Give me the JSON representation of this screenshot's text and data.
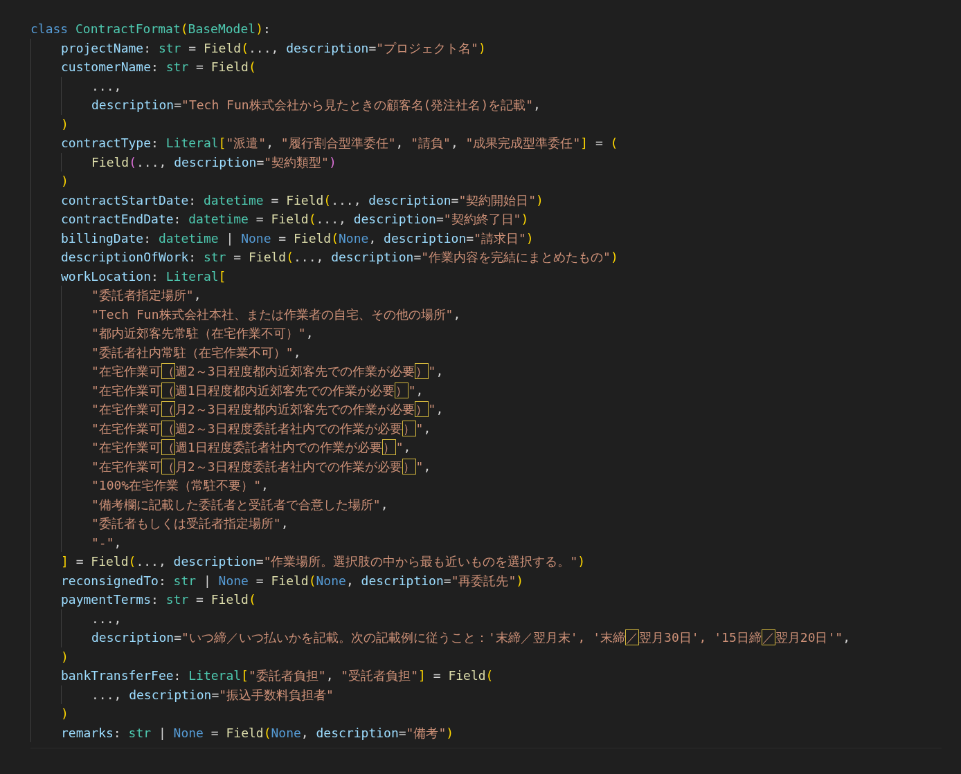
{
  "editor": {
    "lines": [
      {
        "tokens": [
          {
            "kind": "kw",
            "text": "class "
          },
          {
            "kind": "cls",
            "text": "ContractFormat"
          },
          {
            "kind": "p1",
            "text": "("
          },
          {
            "kind": "cls",
            "text": "BaseModel"
          },
          {
            "kind": "p1",
            "text": ")"
          },
          {
            "kind": "op",
            "text": ":"
          }
        ],
        "children": [
          {
            "tokens": [
              {
                "kind": "var",
                "text": "projectName"
              },
              {
                "kind": "op",
                "text": ": "
              },
              {
                "kind": "type",
                "text": "str"
              },
              {
                "kind": "op",
                "text": " = "
              },
              {
                "kind": "fn",
                "text": "Field"
              },
              {
                "kind": "p1",
                "text": "("
              },
              {
                "kind": "op",
                "text": "..., "
              },
              {
                "kind": "var",
                "text": "description"
              },
              {
                "kind": "op",
                "text": "="
              },
              {
                "kind": "str",
                "text": "\"プロジェクト名\""
              },
              {
                "kind": "p1",
                "text": ")"
              }
            ]
          },
          {
            "tokens": [
              {
                "kind": "var",
                "text": "customerName"
              },
              {
                "kind": "op",
                "text": ": "
              },
              {
                "kind": "type",
                "text": "str"
              },
              {
                "kind": "op",
                "text": " = "
              },
              {
                "kind": "fn",
                "text": "Field"
              },
              {
                "kind": "p1",
                "text": "("
              }
            ],
            "children": [
              {
                "tokens": [
                  {
                    "kind": "op",
                    "text": "...,"
                  }
                ]
              },
              {
                "tokens": [
                  {
                    "kind": "var",
                    "text": "description"
                  },
                  {
                    "kind": "op",
                    "text": "="
                  },
                  {
                    "kind": "str",
                    "text": "\"Tech Fun株式会社から見たときの顧客名(発注社名)を記載\""
                  },
                  {
                    "kind": "op",
                    "text": ","
                  }
                ]
              }
            ]
          },
          {
            "tokens": [
              {
                "kind": "p1",
                "text": ")"
              }
            ]
          },
          {
            "tokens": [
              {
                "kind": "var",
                "text": "contractType"
              },
              {
                "kind": "op",
                "text": ": "
              },
              {
                "kind": "type",
                "text": "Literal"
              },
              {
                "kind": "p1",
                "text": "["
              },
              {
                "kind": "str",
                "text": "\"派遣\""
              },
              {
                "kind": "op",
                "text": ", "
              },
              {
                "kind": "str",
                "text": "\"履行割合型準委任\""
              },
              {
                "kind": "op",
                "text": ", "
              },
              {
                "kind": "str",
                "text": "\"請負\""
              },
              {
                "kind": "op",
                "text": ", "
              },
              {
                "kind": "str",
                "text": "\"成果完成型準委任\""
              },
              {
                "kind": "p1",
                "text": "]"
              },
              {
                "kind": "op",
                "text": " = "
              },
              {
                "kind": "p1",
                "text": "("
              }
            ],
            "children": [
              {
                "tokens": [
                  {
                    "kind": "fn",
                    "text": "Field"
                  },
                  {
                    "kind": "p2",
                    "text": "("
                  },
                  {
                    "kind": "op",
                    "text": "..., "
                  },
                  {
                    "kind": "var",
                    "text": "description"
                  },
                  {
                    "kind": "op",
                    "text": "="
                  },
                  {
                    "kind": "str",
                    "text": "\"契約類型\""
                  },
                  {
                    "kind": "p2",
                    "text": ")"
                  }
                ]
              }
            ]
          },
          {
            "tokens": [
              {
                "kind": "p1",
                "text": ")"
              }
            ]
          },
          {
            "tokens": [
              {
                "kind": "var",
                "text": "contractStartDate"
              },
              {
                "kind": "op",
                "text": ": "
              },
              {
                "kind": "type",
                "text": "datetime"
              },
              {
                "kind": "op",
                "text": " = "
              },
              {
                "kind": "fn",
                "text": "Field"
              },
              {
                "kind": "p1",
                "text": "("
              },
              {
                "kind": "op",
                "text": "..., "
              },
              {
                "kind": "var",
                "text": "description"
              },
              {
                "kind": "op",
                "text": "="
              },
              {
                "kind": "str",
                "text": "\"契約開始日\""
              },
              {
                "kind": "p1",
                "text": ")"
              }
            ]
          },
          {
            "tokens": [
              {
                "kind": "var",
                "text": "contractEndDate"
              },
              {
                "kind": "op",
                "text": ": "
              },
              {
                "kind": "type",
                "text": "datetime"
              },
              {
                "kind": "op",
                "text": " = "
              },
              {
                "kind": "fn",
                "text": "Field"
              },
              {
                "kind": "p1",
                "text": "("
              },
              {
                "kind": "op",
                "text": "..., "
              },
              {
                "kind": "var",
                "text": "description"
              },
              {
                "kind": "op",
                "text": "="
              },
              {
                "kind": "str",
                "text": "\"契約終了日\""
              },
              {
                "kind": "p1",
                "text": ")"
              }
            ]
          },
          {
            "tokens": [
              {
                "kind": "var",
                "text": "billingDate"
              },
              {
                "kind": "op",
                "text": ": "
              },
              {
                "kind": "type",
                "text": "datetime"
              },
              {
                "kind": "op",
                "text": " | "
              },
              {
                "kind": "none",
                "text": "None"
              },
              {
                "kind": "op",
                "text": " = "
              },
              {
                "kind": "fn",
                "text": "Field"
              },
              {
                "kind": "p1",
                "text": "("
              },
              {
                "kind": "none",
                "text": "None"
              },
              {
                "kind": "op",
                "text": ", "
              },
              {
                "kind": "var",
                "text": "description"
              },
              {
                "kind": "op",
                "text": "="
              },
              {
                "kind": "str",
                "text": "\"請求日\""
              },
              {
                "kind": "p1",
                "text": ")"
              }
            ]
          },
          {
            "tokens": [
              {
                "kind": "var",
                "text": "descriptionOfWork"
              },
              {
                "kind": "op",
                "text": ": "
              },
              {
                "kind": "type",
                "text": "str"
              },
              {
                "kind": "op",
                "text": " = "
              },
              {
                "kind": "fn",
                "text": "Field"
              },
              {
                "kind": "p1",
                "text": "("
              },
              {
                "kind": "op",
                "text": "..., "
              },
              {
                "kind": "var",
                "text": "description"
              },
              {
                "kind": "op",
                "text": "="
              },
              {
                "kind": "str",
                "text": "\"作業内容を完結にまとめたもの\""
              },
              {
                "kind": "p1",
                "text": ")"
              }
            ]
          },
          {
            "tokens": [
              {
                "kind": "var",
                "text": "workLocation"
              },
              {
                "kind": "op",
                "text": ": "
              },
              {
                "kind": "type",
                "text": "Literal"
              },
              {
                "kind": "p1",
                "text": "["
              }
            ],
            "children": [
              {
                "tokens": [
                  {
                    "kind": "str",
                    "text": "\"委託者指定場所\""
                  },
                  {
                    "kind": "op",
                    "text": ","
                  }
                ]
              },
              {
                "tokens": [
                  {
                    "kind": "str",
                    "text": "\"Tech Fun株式会社本社、または作業者の自宅、その他の場所\""
                  },
                  {
                    "kind": "op",
                    "text": ","
                  }
                ]
              },
              {
                "tokens": [
                  {
                    "kind": "str",
                    "text": "\"都内近郊客先常駐（在宅作業不可）\""
                  },
                  {
                    "kind": "op",
                    "text": ","
                  }
                ]
              },
              {
                "tokens": [
                  {
                    "kind": "str",
                    "text": "\"委託者社内常駐（在宅作業不可）\""
                  },
                  {
                    "kind": "op",
                    "text": ","
                  }
                ]
              },
              {
                "tokens": [
                  {
                    "kind": "str",
                    "text": "\"在宅作業可"
                  },
                  {
                    "kind": "amb",
                    "text": "（"
                  },
                  {
                    "kind": "str",
                    "text": "週2～3日程度都内近郊客先での作業が必要"
                  },
                  {
                    "kind": "amb",
                    "text": "）"
                  },
                  {
                    "kind": "str",
                    "text": "\""
                  },
                  {
                    "kind": "op",
                    "text": ","
                  }
                ]
              },
              {
                "tokens": [
                  {
                    "kind": "str",
                    "text": "\"在宅作業可"
                  },
                  {
                    "kind": "amb",
                    "text": "（"
                  },
                  {
                    "kind": "str",
                    "text": "週1日程度都内近郊客先での作業が必要"
                  },
                  {
                    "kind": "amb",
                    "text": "）"
                  },
                  {
                    "kind": "str",
                    "text": "\""
                  },
                  {
                    "kind": "op",
                    "text": ","
                  }
                ]
              },
              {
                "tokens": [
                  {
                    "kind": "str",
                    "text": "\"在宅作業可"
                  },
                  {
                    "kind": "amb",
                    "text": "（"
                  },
                  {
                    "kind": "str",
                    "text": "月2～3日程度都内近郊客先での作業が必要"
                  },
                  {
                    "kind": "amb",
                    "text": "）"
                  },
                  {
                    "kind": "str",
                    "text": "\""
                  },
                  {
                    "kind": "op",
                    "text": ","
                  }
                ]
              },
              {
                "tokens": [
                  {
                    "kind": "str",
                    "text": "\"在宅作業可"
                  },
                  {
                    "kind": "amb",
                    "text": "（"
                  },
                  {
                    "kind": "str",
                    "text": "週2～3日程度委託者社内での作業が必要"
                  },
                  {
                    "kind": "amb",
                    "text": "）"
                  },
                  {
                    "kind": "str",
                    "text": "\""
                  },
                  {
                    "kind": "op",
                    "text": ","
                  }
                ]
              },
              {
                "tokens": [
                  {
                    "kind": "str",
                    "text": "\"在宅作業可"
                  },
                  {
                    "kind": "amb",
                    "text": "（"
                  },
                  {
                    "kind": "str",
                    "text": "週1日程度委託者社内での作業が必要"
                  },
                  {
                    "kind": "amb",
                    "text": "）"
                  },
                  {
                    "kind": "str",
                    "text": "\""
                  },
                  {
                    "kind": "op",
                    "text": ","
                  }
                ]
              },
              {
                "tokens": [
                  {
                    "kind": "str",
                    "text": "\"在宅作業可"
                  },
                  {
                    "kind": "amb",
                    "text": "（"
                  },
                  {
                    "kind": "str",
                    "text": "月2～3日程度委託者社内での作業が必要"
                  },
                  {
                    "kind": "amb",
                    "text": "）"
                  },
                  {
                    "kind": "str",
                    "text": "\""
                  },
                  {
                    "kind": "op",
                    "text": ","
                  }
                ]
              },
              {
                "tokens": [
                  {
                    "kind": "str",
                    "text": "\"100%在宅作業（常駐不要）\""
                  },
                  {
                    "kind": "op",
                    "text": ","
                  }
                ]
              },
              {
                "tokens": [
                  {
                    "kind": "str",
                    "text": "\"備考欄に記載した委託者と受託者で合意した場所\""
                  },
                  {
                    "kind": "op",
                    "text": ","
                  }
                ]
              },
              {
                "tokens": [
                  {
                    "kind": "str",
                    "text": "\"委託者もしくは受託者指定場所\""
                  },
                  {
                    "kind": "op",
                    "text": ","
                  }
                ]
              },
              {
                "tokens": [
                  {
                    "kind": "str",
                    "text": "\"-\""
                  },
                  {
                    "kind": "op",
                    "text": ","
                  }
                ]
              }
            ]
          },
          {
            "tokens": [
              {
                "kind": "p1",
                "text": "]"
              },
              {
                "kind": "op",
                "text": " = "
              },
              {
                "kind": "fn",
                "text": "Field"
              },
              {
                "kind": "p1",
                "text": "("
              },
              {
                "kind": "op",
                "text": "..., "
              },
              {
                "kind": "var",
                "text": "description"
              },
              {
                "kind": "op",
                "text": "="
              },
              {
                "kind": "str",
                "text": "\"作業場所。選択肢の中から最も近いものを選択する。\""
              },
              {
                "kind": "p1",
                "text": ")"
              }
            ]
          },
          {
            "tokens": [
              {
                "kind": "var",
                "text": "reconsignedTo"
              },
              {
                "kind": "op",
                "text": ": "
              },
              {
                "kind": "type",
                "text": "str"
              },
              {
                "kind": "op",
                "text": " | "
              },
              {
                "kind": "none",
                "text": "None"
              },
              {
                "kind": "op",
                "text": " = "
              },
              {
                "kind": "fn",
                "text": "Field"
              },
              {
                "kind": "p1",
                "text": "("
              },
              {
                "kind": "none",
                "text": "None"
              },
              {
                "kind": "op",
                "text": ", "
              },
              {
                "kind": "var",
                "text": "description"
              },
              {
                "kind": "op",
                "text": "="
              },
              {
                "kind": "str",
                "text": "\"再委託先\""
              },
              {
                "kind": "p1",
                "text": ")"
              }
            ]
          },
          {
            "tokens": [
              {
                "kind": "var",
                "text": "paymentTerms"
              },
              {
                "kind": "op",
                "text": ": "
              },
              {
                "kind": "type",
                "text": "str"
              },
              {
                "kind": "op",
                "text": " = "
              },
              {
                "kind": "fn",
                "text": "Field"
              },
              {
                "kind": "p1",
                "text": "("
              }
            ],
            "children": [
              {
                "tokens": [
                  {
                    "kind": "op",
                    "text": "...,"
                  }
                ]
              },
              {
                "tokens": [
                  {
                    "kind": "var",
                    "text": "description"
                  },
                  {
                    "kind": "op",
                    "text": "="
                  },
                  {
                    "kind": "str",
                    "text": "\"いつ締／いつ払いかを記載。次の記載例に従うこと：'末締／翌月末', '末締"
                  },
                  {
                    "kind": "amb",
                    "text": "／"
                  },
                  {
                    "kind": "str",
                    "text": "翌月30日', '15日締"
                  },
                  {
                    "kind": "amb",
                    "text": "／"
                  },
                  {
                    "kind": "str",
                    "text": "翌月20日'\""
                  },
                  {
                    "kind": "op",
                    "text": ","
                  }
                ]
              }
            ]
          },
          {
            "tokens": [
              {
                "kind": "p1",
                "text": ")"
              }
            ]
          },
          {
            "tokens": [
              {
                "kind": "var",
                "text": "bankTransferFee"
              },
              {
                "kind": "op",
                "text": ": "
              },
              {
                "kind": "type",
                "text": "Literal"
              },
              {
                "kind": "p1",
                "text": "["
              },
              {
                "kind": "str",
                "text": "\"委託者負担\""
              },
              {
                "kind": "op",
                "text": ", "
              },
              {
                "kind": "str",
                "text": "\"受託者負担\""
              },
              {
                "kind": "p1",
                "text": "]"
              },
              {
                "kind": "op",
                "text": " = "
              },
              {
                "kind": "fn",
                "text": "Field"
              },
              {
                "kind": "p1",
                "text": "("
              }
            ],
            "children": [
              {
                "tokens": [
                  {
                    "kind": "op",
                    "text": "..., "
                  },
                  {
                    "kind": "var",
                    "text": "description"
                  },
                  {
                    "kind": "op",
                    "text": "="
                  },
                  {
                    "kind": "str",
                    "text": "\"振込手数料負担者\""
                  }
                ]
              }
            ]
          },
          {
            "tokens": [
              {
                "kind": "p1",
                "text": ")"
              }
            ]
          },
          {
            "tokens": [
              {
                "kind": "var",
                "text": "remarks"
              },
              {
                "kind": "op",
                "text": ": "
              },
              {
                "kind": "type",
                "text": "str"
              },
              {
                "kind": "op",
                "text": " | "
              },
              {
                "kind": "none",
                "text": "None"
              },
              {
                "kind": "op",
                "text": " = "
              },
              {
                "kind": "fn",
                "text": "Field"
              },
              {
                "kind": "p1",
                "text": "("
              },
              {
                "kind": "none",
                "text": "None"
              },
              {
                "kind": "op",
                "text": ", "
              },
              {
                "kind": "var",
                "text": "description"
              },
              {
                "kind": "op",
                "text": "="
              },
              {
                "kind": "str",
                "text": "\"備考\""
              },
              {
                "kind": "p1",
                "text": ")"
              }
            ]
          }
        ]
      }
    ]
  }
}
